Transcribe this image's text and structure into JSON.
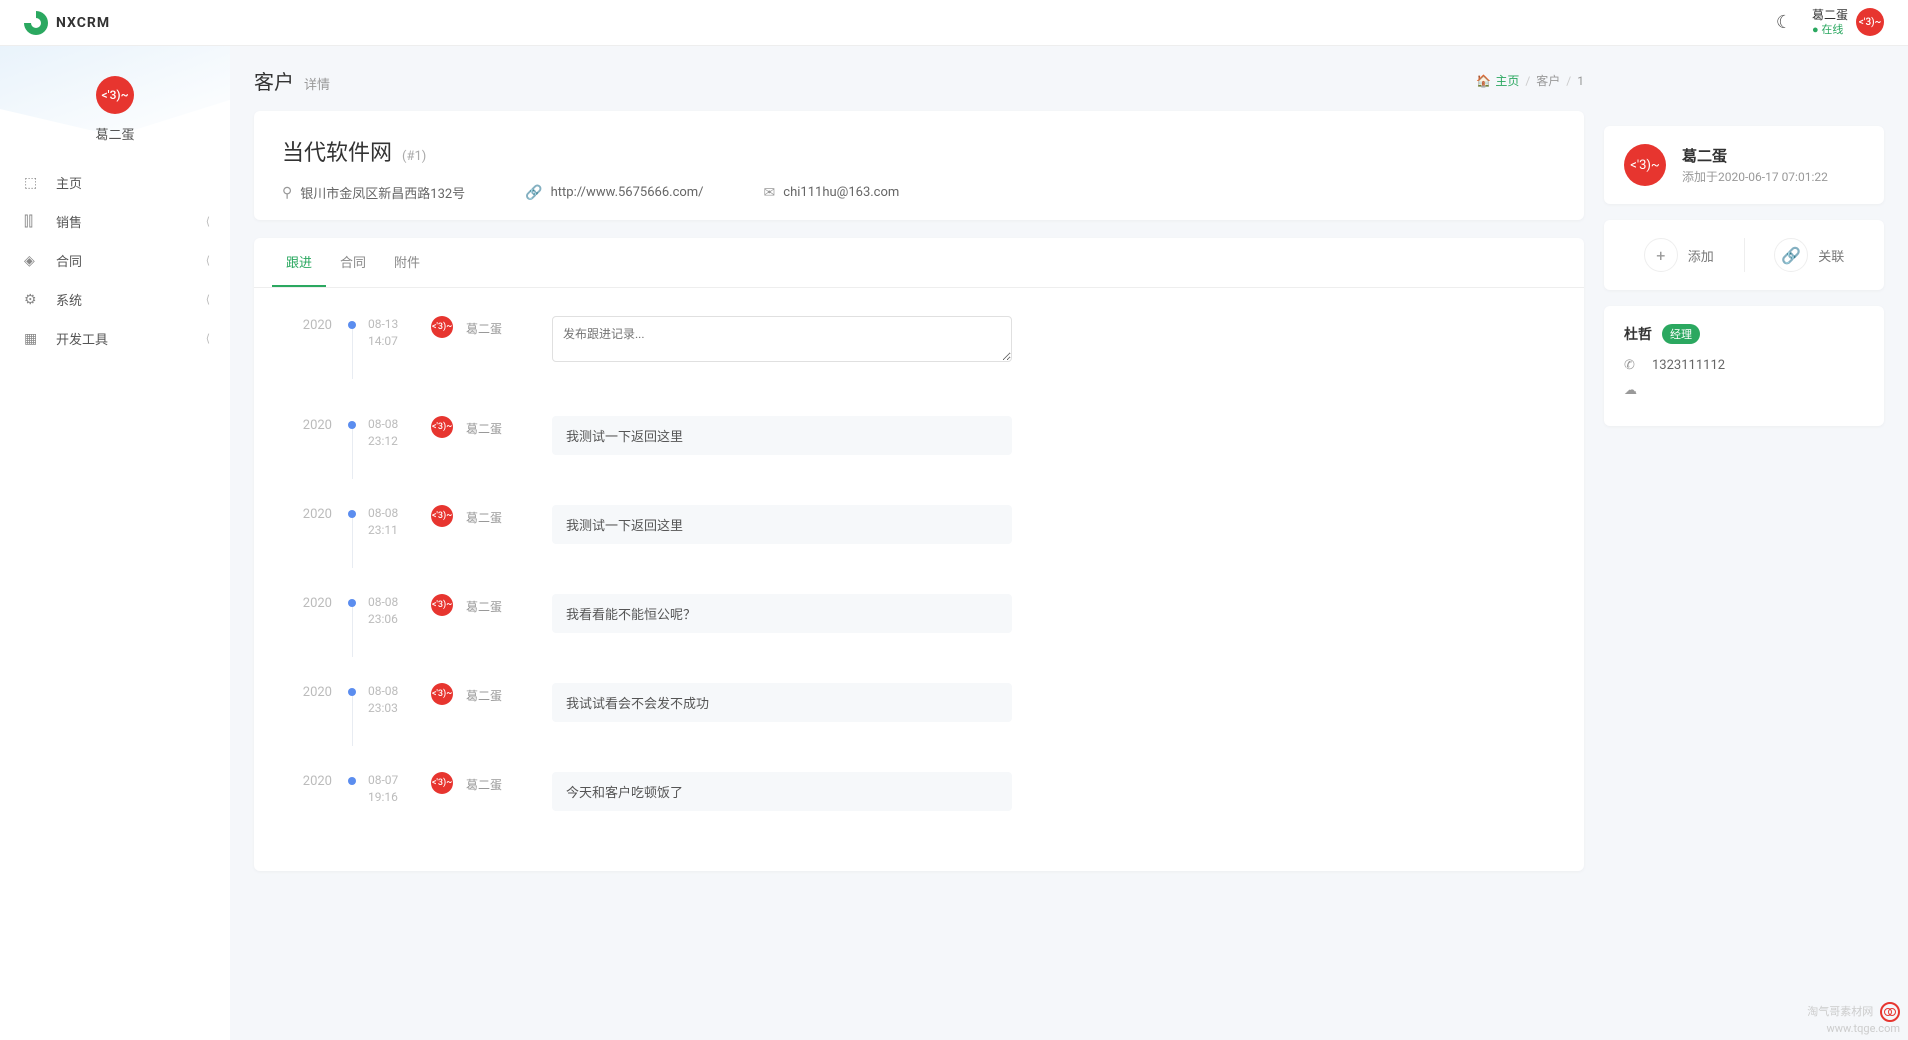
{
  "brand": "NXCRM",
  "header": {
    "user_name": "葛二蛋",
    "status": "在线",
    "avatar_text": "<'3)~"
  },
  "sidebar": {
    "user_name": "葛二蛋",
    "avatar_text": "<'3)~",
    "nav": [
      {
        "label": "主页",
        "icon": "home",
        "has_children": false
      },
      {
        "label": "销售",
        "icon": "chart",
        "has_children": true
      },
      {
        "label": "合同",
        "icon": "diamond",
        "has_children": true
      },
      {
        "label": "系统",
        "icon": "gear",
        "has_children": true
      },
      {
        "label": "开发工具",
        "icon": "tool",
        "has_children": true
      }
    ]
  },
  "page": {
    "title": "客户",
    "subtitle": "详情",
    "breadcrumb": {
      "home": "主页",
      "section": "客户",
      "id": "1"
    }
  },
  "customer": {
    "name": "当代软件网",
    "id_text": "(#1)",
    "address": "银川市金凤区新昌西路132号",
    "website": "http://www.5675666.com/",
    "email": "chi111hu@163.com"
  },
  "tabs": [
    {
      "label": "跟进",
      "active": true
    },
    {
      "label": "合同",
      "active": false
    },
    {
      "label": "附件",
      "active": false
    }
  ],
  "compose_placeholder": "发布跟进记录...",
  "timeline": [
    {
      "year": "2020",
      "date": "08-13",
      "time": "14:07",
      "user": "葛二蛋",
      "avatar": "<'3)~",
      "compose": true
    },
    {
      "year": "2020",
      "date": "08-08",
      "time": "23:12",
      "user": "葛二蛋",
      "avatar": "<'3)~",
      "content": "我测试一下返回这里"
    },
    {
      "year": "2020",
      "date": "08-08",
      "time": "23:11",
      "user": "葛二蛋",
      "avatar": "<'3)~",
      "content": "我测试一下返回这里"
    },
    {
      "year": "2020",
      "date": "08-08",
      "time": "23:06",
      "user": "葛二蛋",
      "avatar": "<'3)~",
      "content": "我看看能不能恒公呢？"
    },
    {
      "year": "2020",
      "date": "08-08",
      "time": "23:03",
      "user": "葛二蛋",
      "avatar": "<'3)~",
      "content": "我试试看会不会发不成功"
    },
    {
      "year": "2020",
      "date": "08-07",
      "time": "19:16",
      "user": "葛二蛋",
      "avatar": "<'3)~",
      "content": "今天和客户吃顿饭了"
    }
  ],
  "owner": {
    "name": "葛二蛋",
    "avatar_text": "<'3)~",
    "added_text": "添加于2020-06-17 07:01:22"
  },
  "actions": {
    "add": "添加",
    "link": "关联"
  },
  "contact": {
    "name": "杜哲",
    "role": "经理",
    "phone": "1323111112"
  },
  "watermark": {
    "line1": "淘气哥素材网",
    "line2": "www.tqge.com"
  }
}
